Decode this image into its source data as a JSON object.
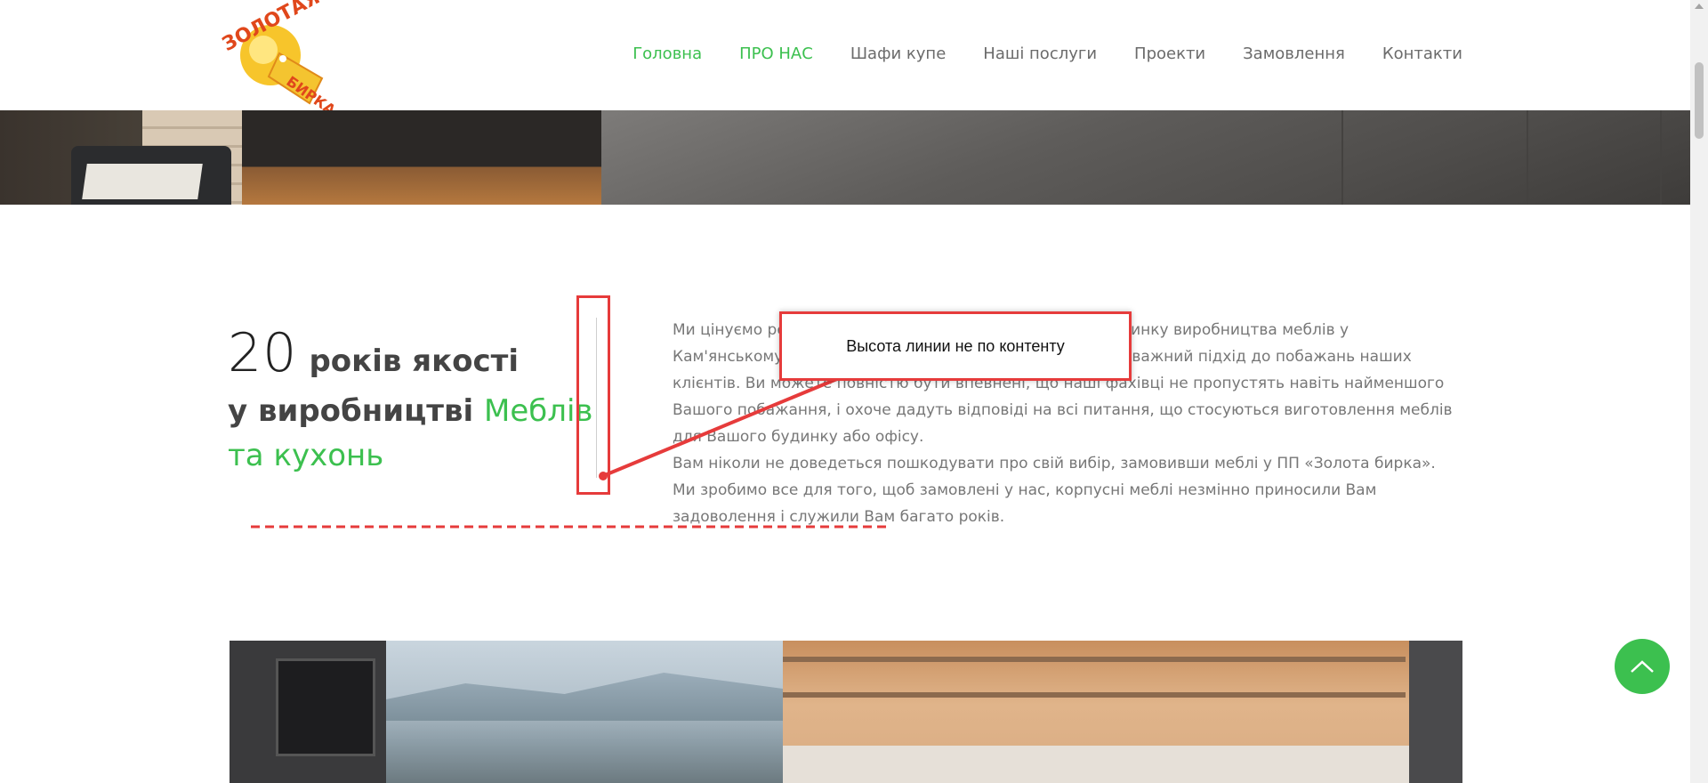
{
  "header": {
    "logo_text": "ЗОЛОТАЯ БИРКА",
    "nav": [
      {
        "label": "Головна",
        "active": true
      },
      {
        "label": "ПРО НАС",
        "active": true
      },
      {
        "label": "Шафи купе",
        "active": false
      },
      {
        "label": "Наші послуги",
        "active": false
      },
      {
        "label": "Проекти",
        "active": false
      },
      {
        "label": "Замовлення",
        "active": false
      },
      {
        "label": "Контакти",
        "active": false
      }
    ]
  },
  "about": {
    "years_number": "20",
    "years_text": "років якості",
    "line2_plain": "у виробництві",
    "line2_green": "Меблів",
    "line3_green": "та кухонь",
    "paragraph1": "Ми цінуємо репутацію, яку заробили за роки роботи на ринку виробництва меблів у Кам'янському і тому вважаємо індивідуальний та дуже уважний підхід до побажань наших клієнтів. Ви можете повністю бути впевнені, що наші фахівці не пропустять навіть найменшого Вашого побажання, і охоче дадуть відповіді на всі питання, що стосуються виготовлення меблів для Вашого будинку або офісу.",
    "paragraph2": "Вам ніколи не доведеться пошкодувати про свій вибір, замовивши меблі у ПП «Золота бирка». Ми зробимо все для того, щоб замовлені у нас, корпусні меблі незмінно приносили Вам задоволення і служили Вам багато років."
  },
  "annotation": {
    "callout_text": "Высота линии не по контенту"
  },
  "colors": {
    "accent": "#3cc04f",
    "annotation": "#e63b3b",
    "text": "#777777"
  },
  "icons": {
    "to_top": "chevron-up-icon"
  }
}
